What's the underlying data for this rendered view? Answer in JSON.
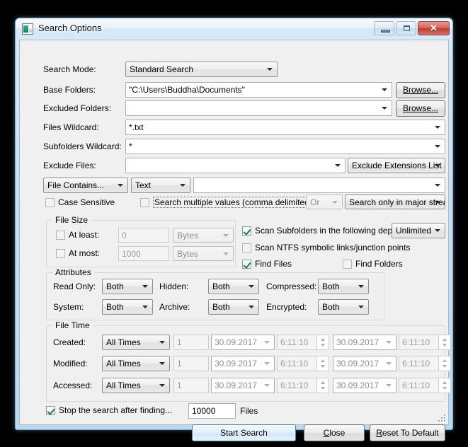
{
  "window": {
    "title": "Search Options",
    "icon": "app-window-icon",
    "minimize_label": "–",
    "maximize_label": "□",
    "close_label": "✕"
  },
  "fields": {
    "search_mode": {
      "label": "Search Mode:",
      "value": "Standard Search"
    },
    "base_folders": {
      "label": "Base Folders:",
      "value": "\"C:\\Users\\Buddha\\Documents\"",
      "browse": "Browse..."
    },
    "excluded_folders": {
      "label": "Excluded Folders:",
      "value": "",
      "browse": "Browse..."
    },
    "files_wildcard": {
      "label": "Files Wildcard:",
      "value": "*.txt"
    },
    "subfolders_wildcard": {
      "label": "Subfolders Wildcard:",
      "value": "*"
    },
    "exclude_files": {
      "label": "Exclude Files:",
      "value": "",
      "extensions_button": "Exclude Extensions List"
    }
  },
  "content_row": {
    "mode": "File Contains...",
    "type": "Text",
    "query": "",
    "case_sensitive": "Case Sensitive",
    "multiple_values": "Search multiple values (comma delimited)",
    "operator": "Or",
    "stream_scope": "Search only in major strea"
  },
  "file_size": {
    "caption": "File Size",
    "at_least": {
      "label": "At least:",
      "value": "0",
      "unit": "Bytes"
    },
    "at_most": {
      "label": "At most:",
      "value": "1000",
      "unit": "Bytes"
    }
  },
  "scan_options": {
    "scan_subfolders": "Scan Subfolders in the following depth:",
    "depth": "Unlimited",
    "scan_ntfs": "Scan NTFS symbolic links/junction points",
    "find_files": "Find Files",
    "find_folders": "Find Folders"
  },
  "attributes": {
    "caption": "Attributes",
    "rows": [
      {
        "label": "Read Only:",
        "value": "Both"
      },
      {
        "label": "Hidden:",
        "value": "Both"
      },
      {
        "label": "Compressed:",
        "value": "Both"
      },
      {
        "label": "System:",
        "value": "Both"
      },
      {
        "label": "Archive:",
        "value": "Both"
      },
      {
        "label": "Encrypted:",
        "value": "Both"
      }
    ]
  },
  "file_time": {
    "caption": "File Time",
    "rows": [
      {
        "label": "Created:",
        "mode": "All Times",
        "amount": "1",
        "date_from": "30.09.2017",
        "time_from": "6:11:10",
        "date_to": "30.09.2017",
        "time_to": "6:11:10"
      },
      {
        "label": "Modified:",
        "mode": "All Times",
        "amount": "1",
        "date_from": "30.09.2017",
        "time_from": "6:11:10",
        "date_to": "30.09.2017",
        "time_to": "6:11:10"
      },
      {
        "label": "Accessed:",
        "mode": "All Times",
        "amount": "1",
        "date_from": "30.09.2017",
        "time_from": "6:11:10",
        "date_to": "30.09.2017",
        "time_to": "6:11:10"
      }
    ]
  },
  "footer": {
    "stop_after": "Stop the search after finding...",
    "stop_count": "10000",
    "files_label": "Files",
    "start_search_pre": "",
    "start_search": "Start Search",
    "close_mnemonic": "C",
    "close_rest": "lose",
    "reset_mnemonic": "R",
    "reset_rest": "eset To Default"
  },
  "colors": {
    "accent": "#3c7fb1",
    "window_frame": "#bcd8ef",
    "client_bg": "#f0f0f0",
    "close_button": "#bc3b31"
  }
}
